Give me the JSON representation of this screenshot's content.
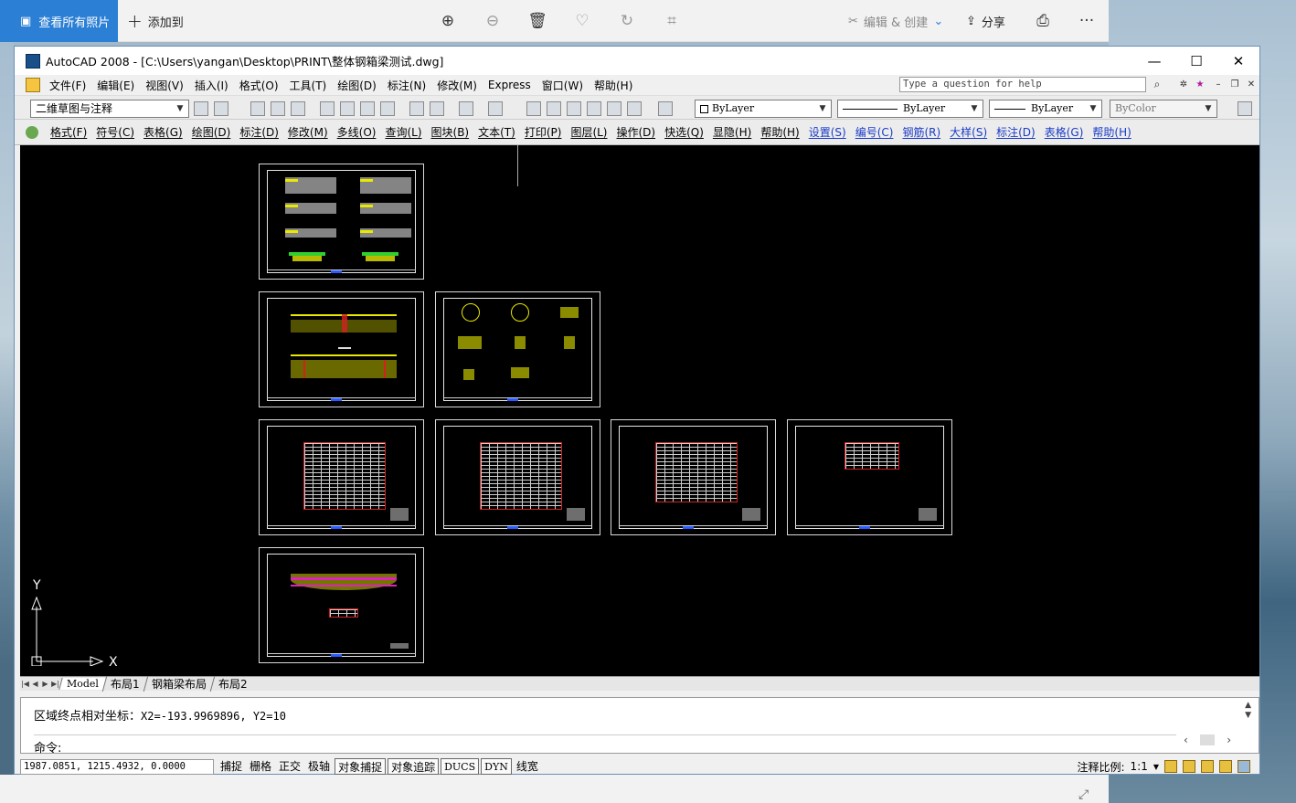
{
  "photos_bar": {
    "all_photos": "查看所有照片",
    "add": "添加到",
    "edit_create": "编辑 & 创建",
    "share": "分享",
    "more": "···"
  },
  "window": {
    "title": "AutoCAD 2008 - [C:\\Users\\yangan\\Desktop\\PRINT\\整体钢箱梁测试.dwg]",
    "minimize": "—",
    "maximize": "☐",
    "close": "✕"
  },
  "menu": [
    "文件(F)",
    "编辑(E)",
    "视图(V)",
    "插入(I)",
    "格式(O)",
    "工具(T)",
    "绘图(D)",
    "标注(N)",
    "修改(M)",
    "Express",
    "窗口(W)",
    "帮助(H)"
  ],
  "help_placeholder": "Type a question for help",
  "toolbar1": {
    "workspace": "二维草图与注释",
    "layer": "ByLayer",
    "linetype": "ByLayer",
    "lineweight": "ByLayer",
    "plotstyle": "ByColor"
  },
  "toolbar2": {
    "items": [
      {
        "label": "格式(F)",
        "blue": false
      },
      {
        "label": "符号(C)",
        "blue": false
      },
      {
        "label": "表格(G)",
        "blue": false
      },
      {
        "label": "绘图(D)",
        "blue": false
      },
      {
        "label": "标注(D)",
        "blue": false
      },
      {
        "label": "修改(M)",
        "blue": false
      },
      {
        "label": "多线(O)",
        "blue": false
      },
      {
        "label": "查询(L)",
        "blue": false
      },
      {
        "label": "图块(B)",
        "blue": false
      },
      {
        "label": "文本(T)",
        "blue": false
      },
      {
        "label": "打印(P)",
        "blue": false
      },
      {
        "label": "图层(L)",
        "blue": false
      },
      {
        "label": "操作(D)",
        "blue": false
      },
      {
        "label": "快选(Q)",
        "blue": false
      },
      {
        "label": "显隐(H)",
        "blue": false
      },
      {
        "label": "帮助(H)",
        "blue": false
      },
      {
        "label": "设置(S)",
        "blue": true
      },
      {
        "label": "编号(C)",
        "blue": true
      },
      {
        "label": "钢筋(R)",
        "blue": true
      },
      {
        "label": "大样(S)",
        "blue": true
      },
      {
        "label": "标注(D)",
        "blue": true
      },
      {
        "label": "表格(G)",
        "blue": true
      },
      {
        "label": "帮助(H)",
        "blue": true
      }
    ]
  },
  "ucs": {
    "x": "X",
    "y": "Y"
  },
  "tabs": [
    "Model",
    "布局1",
    "钢箱梁布局",
    "布局2"
  ],
  "command": {
    "history_label": "区域终点相对坐标：",
    "history_value": "X2=-193.9969896, Y2=10",
    "prompt": "命令:"
  },
  "status": {
    "coords": "1987.0851, 1215.4932, 0.0000",
    "buttons": [
      {
        "label": "捕捉",
        "on": false,
        "mono": false
      },
      {
        "label": "栅格",
        "on": false,
        "mono": false
      },
      {
        "label": "正交",
        "on": false,
        "mono": false
      },
      {
        "label": "极轴",
        "on": false,
        "mono": false
      },
      {
        "label": "对象捕捉",
        "on": true,
        "mono": false
      },
      {
        "label": "对象追踪",
        "on": true,
        "mono": false
      },
      {
        "label": "DUCS",
        "on": true,
        "mono": true
      },
      {
        "label": "DYN",
        "on": true,
        "mono": true
      },
      {
        "label": "线宽",
        "on": false,
        "mono": false
      }
    ],
    "annotation_scale_label": "注释比例:",
    "annotation_scale": "1:1"
  },
  "colors": {
    "photos_accent": "#2b7fd4",
    "canvas": "#000000",
    "menu_blue": "#1a3cc8"
  }
}
